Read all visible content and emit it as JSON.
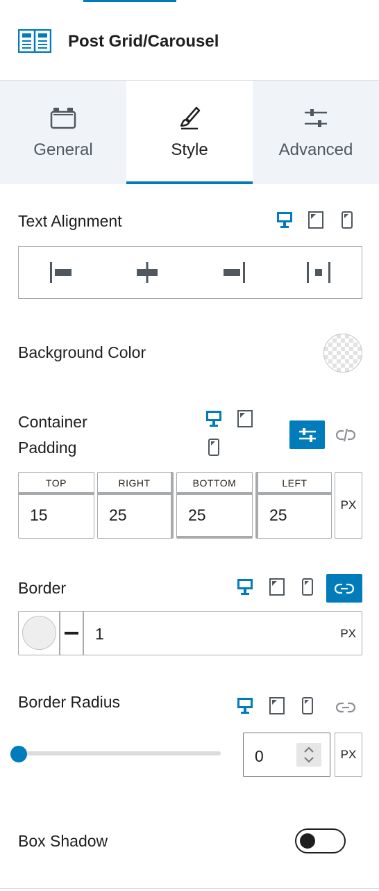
{
  "header": {
    "title": "Post Grid/Carousel",
    "icon": "post-grid-icon"
  },
  "tabs": [
    {
      "label": "General",
      "icon": "briefcase-icon",
      "active": false
    },
    {
      "label": "Style",
      "icon": "brush-icon",
      "active": true
    },
    {
      "label": "Advanced",
      "icon": "sliders-icon",
      "active": false
    }
  ],
  "text_alignment": {
    "label": "Text Alignment",
    "options": [
      "align-left-icon",
      "align-center-icon",
      "align-right-icon",
      "align-justify-icon"
    ]
  },
  "background_color": {
    "label": "Background Color"
  },
  "container_padding": {
    "label_line1": "Container",
    "label_line2": "Padding",
    "fields": [
      {
        "label": "TOP",
        "value": "15"
      },
      {
        "label": "RIGHT",
        "value": "25"
      },
      {
        "label": "BOTTOM",
        "value": "25"
      },
      {
        "label": "LEFT",
        "value": "25"
      }
    ],
    "unit": "PX"
  },
  "border": {
    "label": "Border",
    "width": "1",
    "unit": "PX"
  },
  "border_radius": {
    "label": "Border Radius",
    "value": "0",
    "unit": "PX"
  },
  "box_shadow": {
    "label": "Box Shadow",
    "enabled": false
  },
  "colors": {
    "accent": "#007cba",
    "border": "#a7aaad",
    "tab_bg": "#f0f3f8",
    "text": "#1e1e1e"
  }
}
